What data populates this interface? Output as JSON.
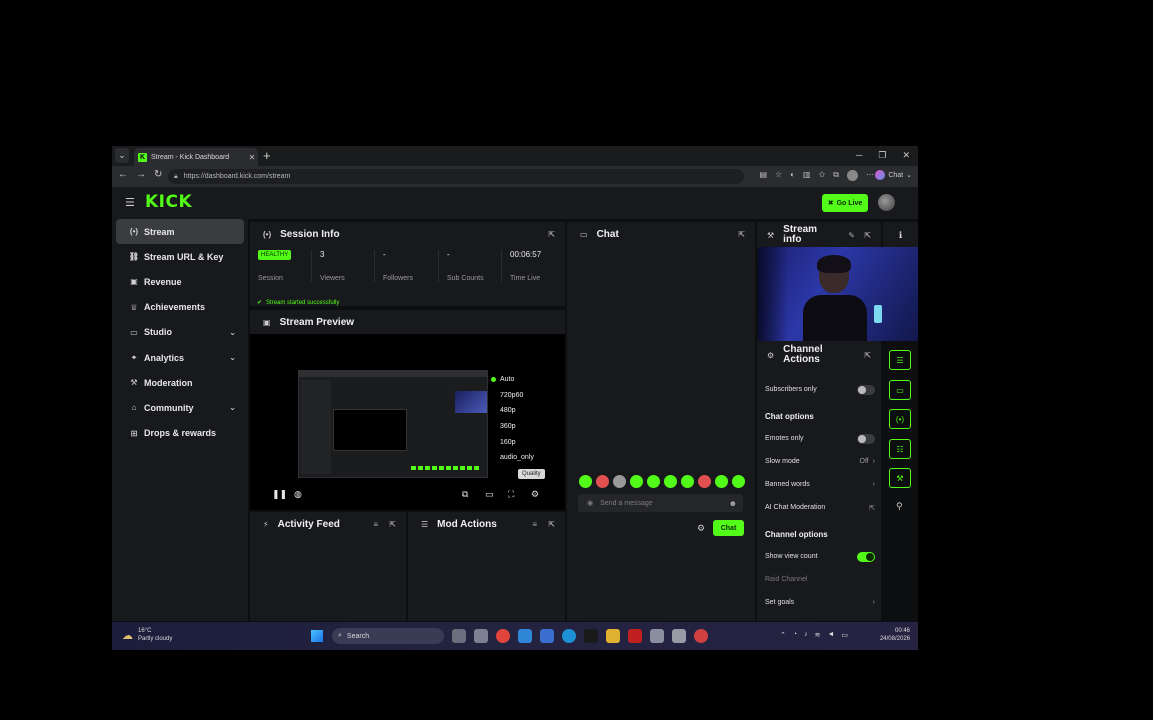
{
  "browser": {
    "tab_title": "Stream - Kick Dashboard",
    "url": "https://dashboard.kick.com/stream",
    "chat_label": "Chat"
  },
  "header": {
    "logo": "KICK",
    "go_live": "Go Live"
  },
  "sidebar": {
    "items": [
      {
        "label": "Stream",
        "icon": "broadcast-icon"
      },
      {
        "label": "Stream URL & Key",
        "icon": "link-icon"
      },
      {
        "label": "Revenue",
        "icon": "revenue-icon"
      },
      {
        "label": "Achievements",
        "icon": "trophy-icon"
      },
      {
        "label": "Studio",
        "icon": "studio-icon"
      },
      {
        "label": "Analytics",
        "icon": "analytics-icon"
      },
      {
        "label": "Moderation",
        "icon": "hammer-icon"
      },
      {
        "label": "Community",
        "icon": "community-icon"
      },
      {
        "label": "Drops & rewards",
        "icon": "gift-icon"
      }
    ]
  },
  "session_info": {
    "title": "Session Info",
    "health": "HEALTHY",
    "session_label": "Session",
    "viewers_value": "3",
    "viewers_label": "Viewers",
    "followers_value": "-",
    "followers_label": "Followers",
    "subs_value": "-",
    "subs_label": "Sub Counts",
    "time_value": "00:06:57",
    "time_label": "Time Live",
    "toast": "Stream started successfully"
  },
  "stream_preview": {
    "title": "Stream Preview",
    "quality_options": [
      "Auto",
      "720p60",
      "480p",
      "360p",
      "160p",
      "audio_only"
    ],
    "quality_selected": "Auto",
    "quality_tooltip": "Quality"
  },
  "activity_feed": {
    "title": "Activity Feed"
  },
  "mod_actions": {
    "title": "Mod Actions"
  },
  "chat": {
    "title": "Chat",
    "placeholder": "Send a message",
    "send_label": "Chat"
  },
  "stream_info": {
    "title": "Stream info"
  },
  "channel_actions": {
    "title": "Channel Actions",
    "subscribers_only": "Subscribers only",
    "chat_options": "Chat options",
    "emotes_only": "Emotes only",
    "slow_mode": "Slow mode",
    "slow_mode_value": "Off",
    "banned_words": "Banned words",
    "ai_moderation": "AI Chat Moderation",
    "channel_options": "Channel options",
    "show_view_count": "Show view count",
    "raid_channel": "Raid Channel",
    "set_goals": "Set goals"
  },
  "taskbar": {
    "temp": "16°C",
    "weather": "Partly cloudy",
    "search": "Search",
    "time": "00:46",
    "date": "24/08/2026"
  }
}
